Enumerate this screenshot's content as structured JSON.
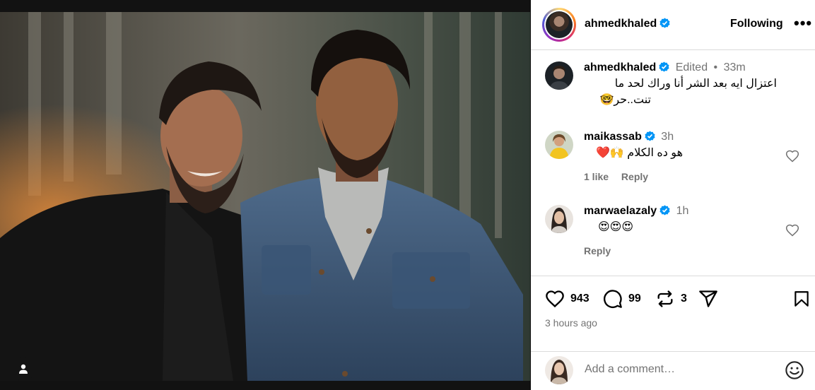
{
  "header": {
    "username": "ahmedkhaled",
    "follow_label": "Following",
    "more_label": "•••"
  },
  "caption": {
    "username": "ahmedkhaled",
    "edited": "Edited",
    "dot": "•",
    "time": "33m",
    "line1": "اعتزال ايه بعد الشر أنا وراك لحد ما",
    "line2": "تنت..حر🤓"
  },
  "comments": [
    {
      "username": "maikassab",
      "time": "3h",
      "text": "هو ده الكلام 🙌❤️",
      "likes": "1 like",
      "reply": "Reply"
    },
    {
      "username": "marwaelazaly",
      "time": "1h",
      "text": "😍😍😍",
      "reply": "Reply"
    }
  ],
  "stats": {
    "likes": "943",
    "comments": "99",
    "reposts": "3"
  },
  "time_ago": "3 hours ago",
  "add_comment": {
    "placeholder": "Add a comment…"
  },
  "colors": {
    "verified": "#0095f6",
    "muted": "#737373",
    "border": "#dbdbdb"
  },
  "icons": [
    "heart-icon",
    "comment-icon",
    "repost-icon",
    "share-icon",
    "bookmark-icon",
    "emoji-icon",
    "verified-icon",
    "user-tag-icon"
  ]
}
